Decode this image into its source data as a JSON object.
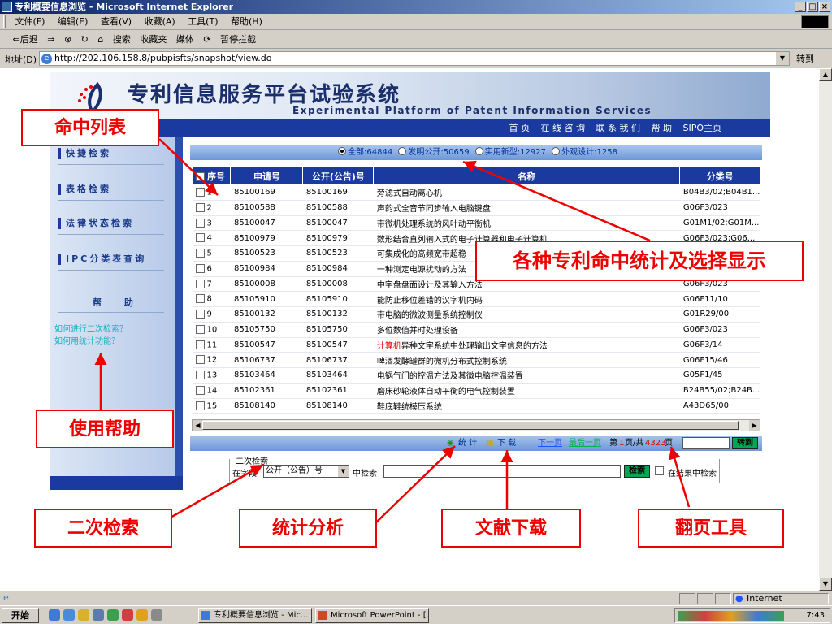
{
  "window": {
    "title": "专利概要信息浏览 - Microsoft Internet Explorer",
    "buttons": [
      "_",
      "□",
      "×"
    ]
  },
  "menubar": [
    "文件(F)",
    "编辑(E)",
    "查看(V)",
    "收藏(A)",
    "工具(T)",
    "帮助(H)"
  ],
  "toolbar": {
    "back": "⇐后退",
    "forward": "⇒",
    "stop": "⊗",
    "refresh": "↻",
    "home": "⌂",
    "search": "搜索",
    "favorites": "收藏夹",
    "media": "媒体",
    "history": "⟳",
    "popup": "暂停拦截"
  },
  "address": {
    "label": "地址(D)",
    "url": "http://202.106.158.8/pubpisfts/snapshot/view.do",
    "go": "转到"
  },
  "page": {
    "site_title": "专利信息服务平台试验系统",
    "site_subtitle": "Experimental Platform of Patent Information Services",
    "nav": [
      "首 页",
      "在 线 咨 询",
      "联 系 我 们",
      "帮 助",
      "SIPO主页"
    ],
    "sidebar": {
      "items": [
        "快捷检索",
        "表格检索",
        "法律状态检索",
        "IPC分类表查询"
      ],
      "help_title": "帮 助",
      "help_links": [
        "如何进行二次检索？",
        "如何用统计功能？"
      ]
    },
    "filter": {
      "options": [
        {
          "label": "全部:64844",
          "selected": true
        },
        {
          "label": "发明公开:50659",
          "selected": false
        },
        {
          "label": "实用新型:12927",
          "selected": false
        },
        {
          "label": "外观设计:1258",
          "selected": false
        }
      ]
    },
    "table": {
      "headers": [
        "序号",
        "申请号",
        "公开(公告)号",
        "名称",
        "分类号"
      ],
      "rows": [
        {
          "no": "1",
          "app": "85100169",
          "pub": "85100169",
          "name": "旁滤式自动离心机",
          "cls": "B04B3/02;B04B1..."
        },
        {
          "no": "2",
          "app": "85100588",
          "pub": "85100588",
          "name": "声韵式全音节同步输入电脑键盘",
          "cls": "G06F3/023"
        },
        {
          "no": "3",
          "app": "85100047",
          "pub": "85100047",
          "name": "带微机处理系统的风叶动平衡机",
          "cls": "G01M1/02;G01M..."
        },
        {
          "no": "4",
          "app": "85100979",
          "pub": "85100979",
          "name": "数形结合直列输入式的电子计算器和电子计算机",
          "cls": "G06F3/023;G06..."
        },
        {
          "no": "5",
          "app": "85100523",
          "pub": "85100523",
          "name": "可集成化的高频宽带超稳",
          "cls": ""
        },
        {
          "no": "6",
          "app": "85100984",
          "pub": "85100984",
          "name": "一种测定电源扰动的方法",
          "cls": ""
        },
        {
          "no": "7",
          "app": "85100008",
          "pub": "85100008",
          "name": "中字盘盘面设计及其输入方法",
          "cls": "G06F3/023"
        },
        {
          "no": "8",
          "app": "85105910",
          "pub": "85105910",
          "name": "能防止移位差错的汉字机内码",
          "cls": "G06F11/10"
        },
        {
          "no": "9",
          "app": "85100132",
          "pub": "85100132",
          "name": "带电脑的微波测量系统控制仪",
          "cls": "G01R29/00"
        },
        {
          "no": "10",
          "app": "85105750",
          "pub": "85105750",
          "name": "多位数值并时处理设备",
          "cls": "G06F3/023"
        },
        {
          "no": "11",
          "app": "85100547",
          "pub": "85100547",
          "name_hl": "计算机",
          "name": "异种文字系统中处理输出文字信息的方法",
          "cls": "G06F3/14"
        },
        {
          "no": "12",
          "app": "85106737",
          "pub": "85106737",
          "name": "啤酒发酵罐群的微机分布式控制系统",
          "cls": "G06F15/46"
        },
        {
          "no": "13",
          "app": "85103464",
          "pub": "85103464",
          "name": "电锅气门的控温方法及其微电脑控温装置",
          "cls": "G05F1/45"
        },
        {
          "no": "14",
          "app": "85102361",
          "pub": "85102361",
          "name": "磨床砂轮液体自动平衡的电气控制装置",
          "cls": "B24B55/02;B24B..."
        },
        {
          "no": "15",
          "app": "85108140",
          "pub": "85108140",
          "name": "鞋底鞋统模压系统",
          "cls": "A43D65/00"
        }
      ]
    },
    "pager": {
      "stats": "统 计",
      "download": "下 载",
      "next": "下一页",
      "last": "最后一页",
      "page_prefix": "第",
      "current": "1",
      "page_mid": "页/共",
      "total": "4323",
      "page_suffix": "页",
      "go": "转到"
    },
    "secondary": {
      "legend": "二次检索",
      "field_label": "在字段",
      "field_value": "公开（公告）号",
      "in_label": "中检索",
      "search_btn": "检索",
      "in_results": "在结果中检索"
    }
  },
  "annotations": {
    "hit_list": "命中列表",
    "stats_display": "各种专利命中统计及选择显示",
    "use_help": "使用帮助",
    "secondary_search": "二次检索",
    "stats_analysis": "统计分析",
    "doc_download": "文献下载",
    "paging_tool": "翻页工具"
  },
  "status": {
    "zone": "Internet"
  },
  "taskbar": {
    "start": "开始",
    "items": [
      "专利概要信息浏览 - Mic...",
      "Microsoft PowerPoint - [..."
    ],
    "clock": "7:43"
  }
}
